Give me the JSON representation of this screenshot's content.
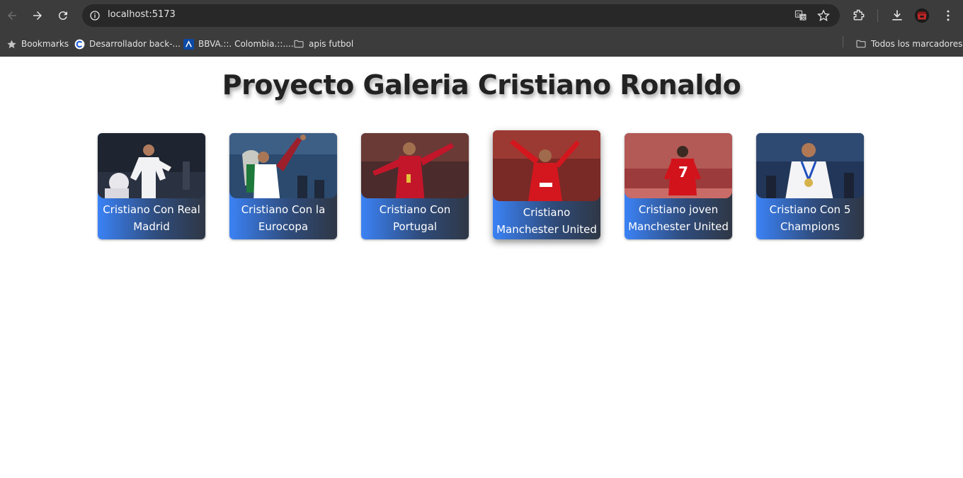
{
  "browser": {
    "url": "localhost:5173",
    "bookmarks": [
      {
        "label": "Bookmarks",
        "icon": "star-icon"
      },
      {
        "label": "Desarrollador back-...",
        "icon": "c-logo-icon"
      },
      {
        "label": "BBVA.::. Colombia.::....",
        "icon": "bbva-logo-icon"
      },
      {
        "label": "apis futbol",
        "icon": "folder-icon"
      }
    ],
    "all_bookmarks": "Todos los marcadores"
  },
  "page": {
    "title": "Proyecto Galeria Cristiano Ronaldo",
    "cards": [
      {
        "caption": "Cristiano Con Real Madrid"
      },
      {
        "caption": "Cristiano Con la Eurocopa"
      },
      {
        "caption": "Cristiano Con Portugal"
      },
      {
        "caption": "Cristiano Manchester United"
      },
      {
        "caption": "Cristiano joven Manchester United"
      },
      {
        "caption": "Cristiano Con 5 Champions"
      }
    ]
  },
  "colors": {
    "chrome": "#3c3c3c",
    "omnibox": "#282828",
    "card_gradient_start": "#3b82f6",
    "card_gradient_end": "#2f3745",
    "title": "#222222"
  }
}
